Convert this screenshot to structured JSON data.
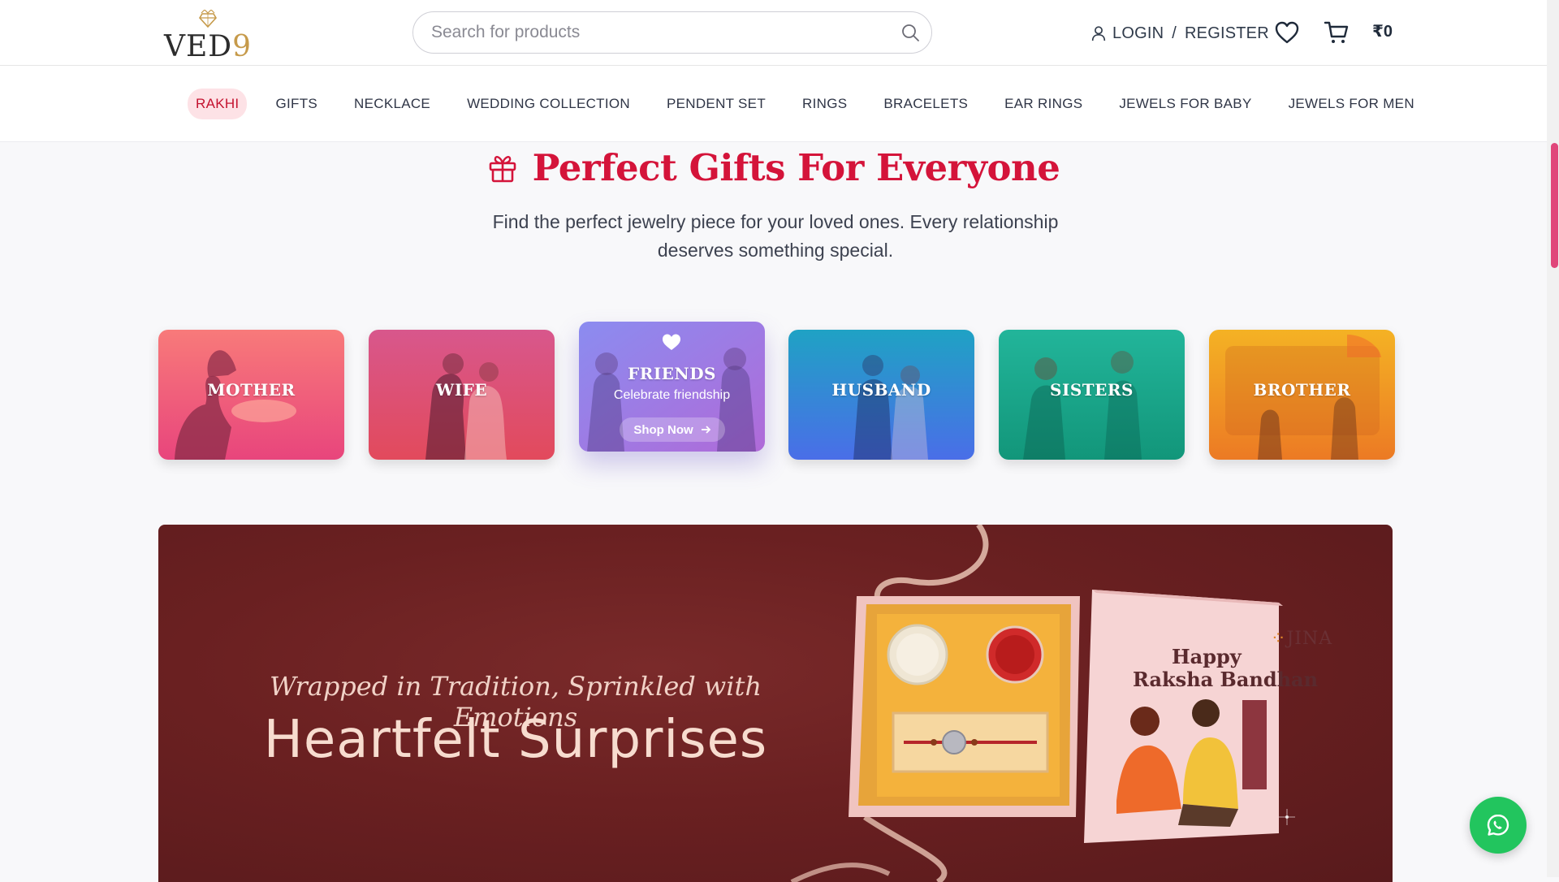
{
  "header": {
    "logo_text": "VED",
    "logo_digit": "9",
    "search_placeholder": "Search for products",
    "login_label": "LOGIN",
    "separator": "/",
    "register_label": "REGISTER",
    "cart_amount": "₹0"
  },
  "nav": {
    "items": [
      {
        "label": "RAKHI",
        "active": true
      },
      {
        "label": "GIFTS"
      },
      {
        "label": "NECKLACE"
      },
      {
        "label": "WEDDING COLLECTION"
      },
      {
        "label": "PENDENT SET"
      },
      {
        "label": "RINGS"
      },
      {
        "label": "BRACELETS"
      },
      {
        "label": "EAR RINGS"
      },
      {
        "label": "JEWELS FOR BABY"
      },
      {
        "label": "JEWELS FOR MEN"
      }
    ]
  },
  "hero": {
    "title": "Perfect Gifts For Everyone",
    "subtitle_line1": "Find the perfect jewelry piece for your loved ones. Every relationship",
    "subtitle_line2": "deserves something special."
  },
  "categories": [
    {
      "label": "MOTHER"
    },
    {
      "label": "WIFE"
    },
    {
      "label": "FRIENDS",
      "tagline": "Celebrate friendship",
      "cta": "Shop Now"
    },
    {
      "label": "HUSBAND"
    },
    {
      "label": "SISTERS"
    },
    {
      "label": "BROTHER"
    }
  ],
  "banner": {
    "tagline": "Wrapped in Tradition, Sprinkled with Emotions",
    "headline": "Heartfelt Surprises",
    "card_line1": "Happy",
    "card_line2": "Raksha Bandhan",
    "brand": "JINA"
  },
  "colors": {
    "accent": "#d4143a",
    "nav_active_bg": "#fde2e6",
    "whatsapp": "#22c55e",
    "scrollbar": "#e0467a"
  }
}
